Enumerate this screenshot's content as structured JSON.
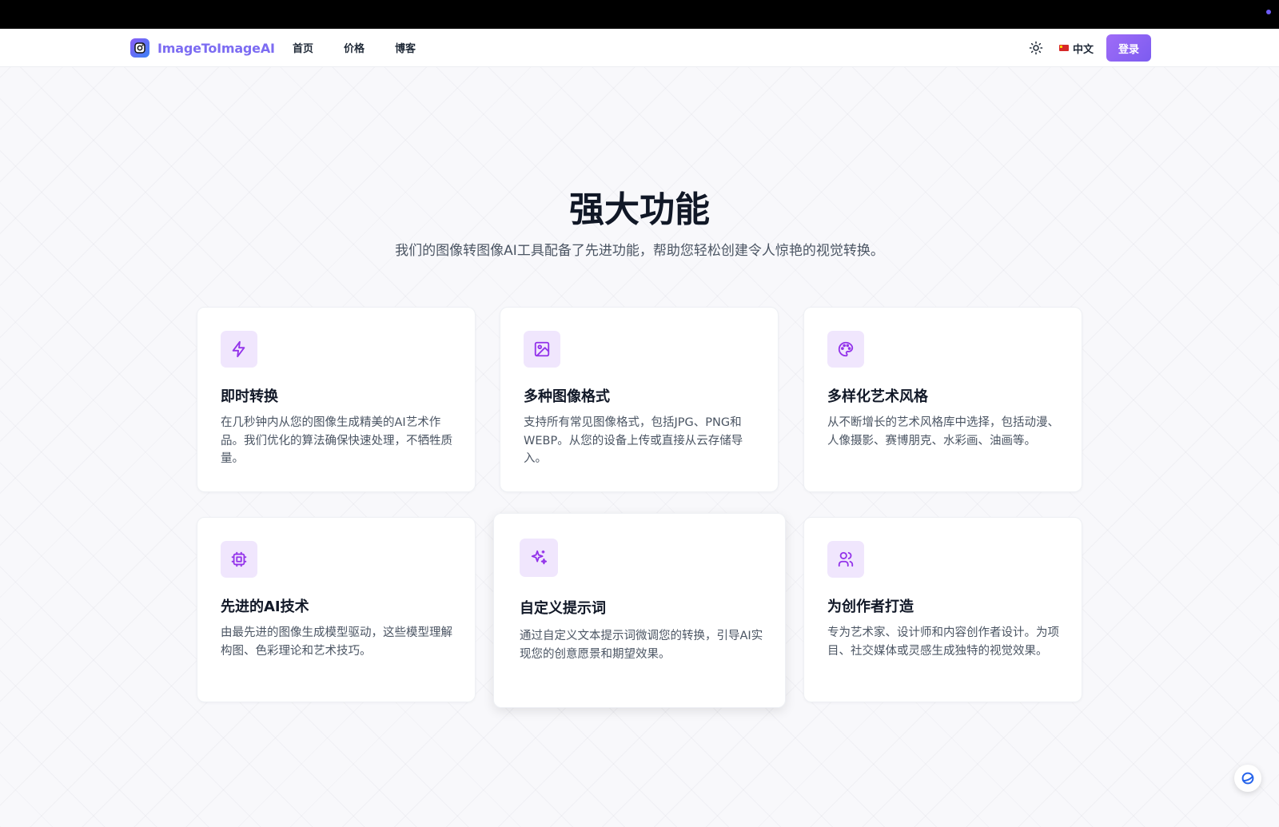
{
  "brand": {
    "name": "ImageToImageAI"
  },
  "nav": {
    "links": [
      "首页",
      "价格",
      "博客"
    ]
  },
  "header_right": {
    "language": "中文",
    "login_label": "登录"
  },
  "hero": {
    "title": "强大功能",
    "subtitle": "我们的图像转图像AI工具配备了先进功能，帮助您轻松创建令人惊艳的视觉转换。"
  },
  "features": [
    {
      "icon": "lightning-icon",
      "title": "即时转换",
      "desc": "在几秒钟内从您的图像生成精美的AI艺术作品。我们优化的算法确保快速处理，不牺牲质量。"
    },
    {
      "icon": "image-icon",
      "title": "多种图像格式",
      "desc": "支持所有常见图像格式，包括JPG、PNG和WEBP。从您的设备上传或直接从云存储导入。"
    },
    {
      "icon": "palette-icon",
      "title": "多样化艺术风格",
      "desc": "从不断增长的艺术风格库中选择，包括动漫、人像摄影、赛博朋克、水彩画、油画等。"
    },
    {
      "icon": "cpu-icon",
      "title": "先进的AI技术",
      "desc": "由最先进的图像生成模型驱动，这些模型理解构图、色彩理论和艺术技巧。"
    },
    {
      "icon": "sparkles-icon",
      "title": "自定义提示词",
      "desc": "通过自定义文本提示词微调您的转换，引导AI实现您的创意愿景和期望效果。"
    },
    {
      "icon": "users-icon",
      "title": "为创作者打造",
      "desc": "专为艺术家、设计师和内容创作者设计。为项目、社交媒体或灵感生成独特的视觉效果。"
    }
  ],
  "colors": {
    "accent": "#8b5cf6",
    "icon_bg": "#f0e6fd",
    "brand_text": "#7c6cf2"
  }
}
